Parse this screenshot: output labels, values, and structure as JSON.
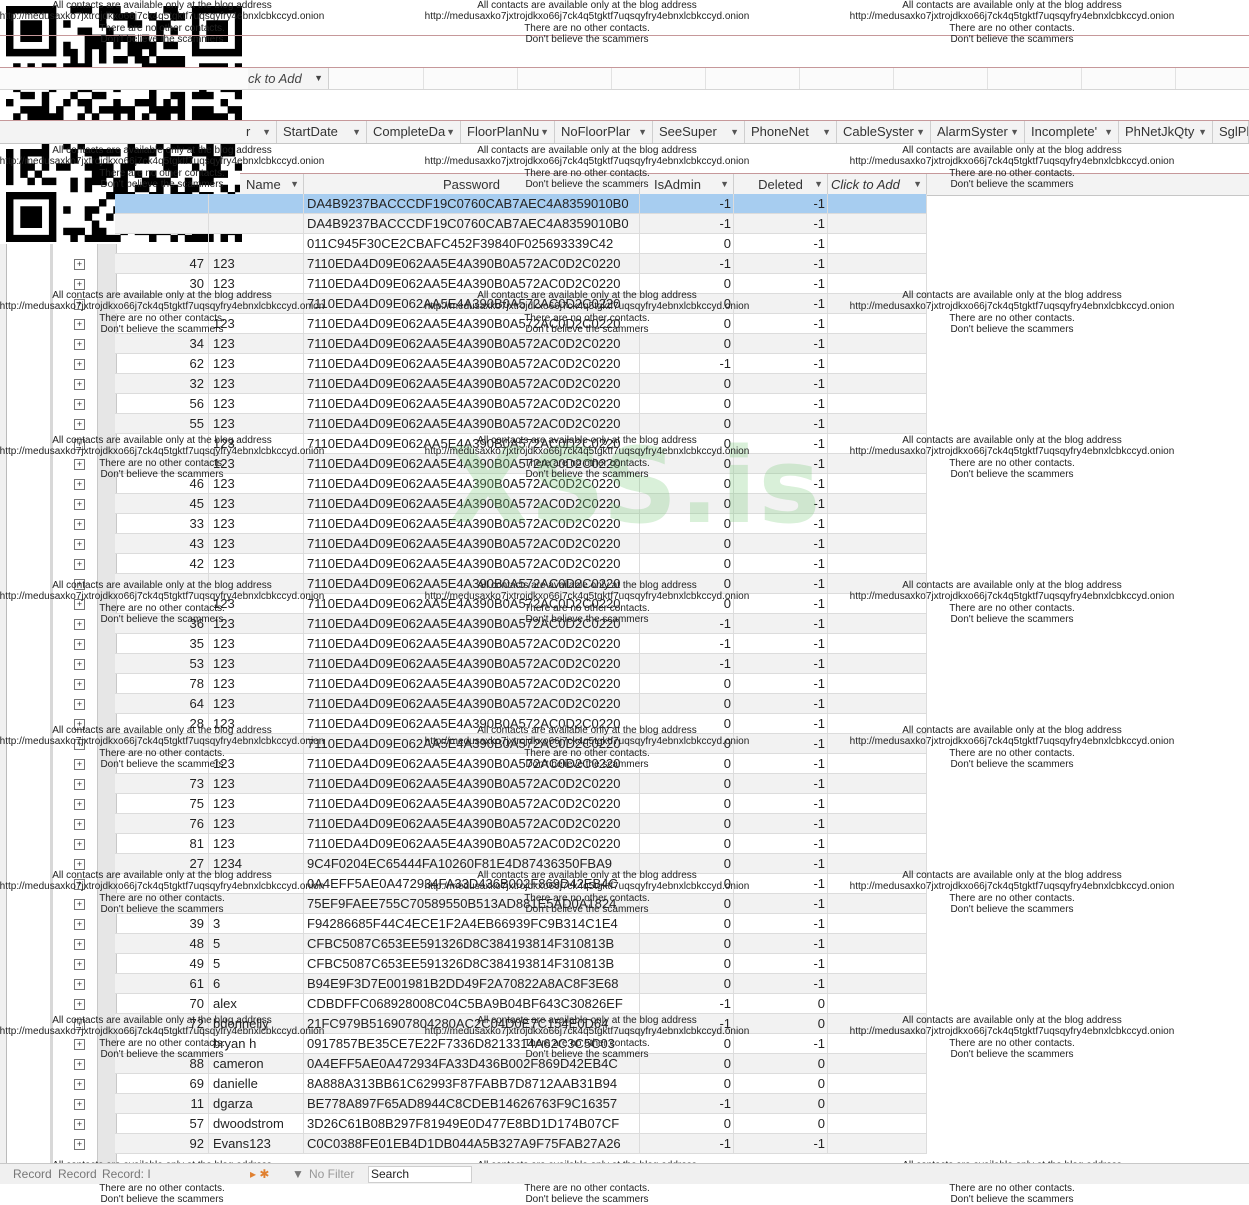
{
  "watermark": {
    "line1": "All contacts are available only at the blog address",
    "line2": "http://medusaxko7jxtrojdkxo66j7ck4q5tgktf7uqsqyfry4ebnxlcbkccyd.onion",
    "line3": "There are no other contacts.",
    "line4": "Don't believe the scammers",
    "big": "XSS.is"
  },
  "top_table": {
    "click_to_add": "ck to Add",
    "columns": [
      "r",
      "StartDate",
      "CompleteDa",
      "FloorPlanNu",
      "NoFloorPlar",
      "SeeSuper",
      "PhoneNet",
      "CableSyster",
      "AlarmSyster",
      "Incomplete'",
      "PhNetJkQty",
      "SglPh"
    ]
  },
  "sub_table": {
    "columns": [
      "Name",
      "Password",
      "IsAdmin",
      "Deleted",
      "Click to Add"
    ],
    "rows": [
      {
        "id": "",
        "name": "",
        "pw": "DA4B9237BACCCDF19C0760CAB7AEC4A8359010B0",
        "admin": "-1",
        "del": "-1"
      },
      {
        "id": "",
        "name": "",
        "pw": "DA4B9237BACCCDF19C0760CAB7AEC4A8359010B0",
        "admin": "-1",
        "del": "-1"
      },
      {
        "id": "",
        "name": "",
        "pw": "011C945F30CE2CBAFC452F39840F025693339C42",
        "admin": "0",
        "del": "-1"
      },
      {
        "id": "47",
        "name": "123",
        "pw": "7110EDA4D09E062AA5E4A390B0A572AC0D2C0220",
        "admin": "-1",
        "del": "-1"
      },
      {
        "id": "30",
        "name": "123",
        "pw": "7110EDA4D09E062AA5E4A390B0A572AC0D2C0220",
        "admin": "0",
        "del": "-1"
      },
      {
        "id": "",
        "name": "",
        "pw": "7110EDA4D09E062AA5E4A390B0A572AC0D2C0220",
        "admin": "0",
        "del": "-1"
      },
      {
        "id": "",
        "name": "123",
        "pw": "7110EDA4D09E062AA5E4A390B0A572AC0D2C0220",
        "admin": "0",
        "del": "-1"
      },
      {
        "id": "34",
        "name": "123",
        "pw": "7110EDA4D09E062AA5E4A390B0A572AC0D2C0220",
        "admin": "0",
        "del": "-1"
      },
      {
        "id": "62",
        "name": "123",
        "pw": "7110EDA4D09E062AA5E4A390B0A572AC0D2C0220",
        "admin": "-1",
        "del": "-1"
      },
      {
        "id": "32",
        "name": "123",
        "pw": "7110EDA4D09E062AA5E4A390B0A572AC0D2C0220",
        "admin": "0",
        "del": "-1"
      },
      {
        "id": "56",
        "name": "123",
        "pw": "7110EDA4D09E062AA5E4A390B0A572AC0D2C0220",
        "admin": "0",
        "del": "-1"
      },
      {
        "id": "55",
        "name": "123",
        "pw": "7110EDA4D09E062AA5E4A390B0A572AC0D2C0220",
        "admin": "0",
        "del": "-1"
      },
      {
        "id": "",
        "name": "123",
        "pw": "7110EDA4D09E062AA5E4A390B0A572AC0D2C0220",
        "admin": "0",
        "del": "-1"
      },
      {
        "id": "",
        "name": "123",
        "pw": "7110EDA4D09E062AA5E4A390B0A572AC0D2C0220",
        "admin": "0",
        "del": "-1"
      },
      {
        "id": "46",
        "name": "123",
        "pw": "7110EDA4D09E062AA5E4A390B0A572AC0D2C0220",
        "admin": "0",
        "del": "-1"
      },
      {
        "id": "45",
        "name": "123",
        "pw": "7110EDA4D09E062AA5E4A390B0A572AC0D2C0220",
        "admin": "0",
        "del": "-1"
      },
      {
        "id": "33",
        "name": "123",
        "pw": "7110EDA4D09E062AA5E4A390B0A572AC0D2C0220",
        "admin": "0",
        "del": "-1"
      },
      {
        "id": "43",
        "name": "123",
        "pw": "7110EDA4D09E062AA5E4A390B0A572AC0D2C0220",
        "admin": "0",
        "del": "-1"
      },
      {
        "id": "42",
        "name": "123",
        "pw": "7110EDA4D09E062AA5E4A390B0A572AC0D2C0220",
        "admin": "0",
        "del": "-1"
      },
      {
        "id": "",
        "name": "",
        "pw": "7110EDA4D09E062AA5E4A390B0A572AC0D2C0220",
        "admin": "0",
        "del": "-1"
      },
      {
        "id": "",
        "name": "123",
        "pw": "7110EDA4D09E062AA5E4A390B0A572AC0D2C0220",
        "admin": "0",
        "del": "-1"
      },
      {
        "id": "36",
        "name": "123",
        "pw": "7110EDA4D09E062AA5E4A390B0A572AC0D2C0220",
        "admin": "-1",
        "del": "-1"
      },
      {
        "id": "35",
        "name": "123",
        "pw": "7110EDA4D09E062AA5E4A390B0A572AC0D2C0220",
        "admin": "-1",
        "del": "-1"
      },
      {
        "id": "53",
        "name": "123",
        "pw": "7110EDA4D09E062AA5E4A390B0A572AC0D2C0220",
        "admin": "-1",
        "del": "-1"
      },
      {
        "id": "78",
        "name": "123",
        "pw": "7110EDA4D09E062AA5E4A390B0A572AC0D2C0220",
        "admin": "0",
        "del": "-1"
      },
      {
        "id": "64",
        "name": "123",
        "pw": "7110EDA4D09E062AA5E4A390B0A572AC0D2C0220",
        "admin": "0",
        "del": "-1"
      },
      {
        "id": "28",
        "name": "123",
        "pw": "7110EDA4D09E062AA5E4A390B0A572AC0D2C0220",
        "admin": "0",
        "del": "-1"
      },
      {
        "id": "",
        "name": "",
        "pw": "7110EDA4D09E062AA5E4A390B0A572AC0D2C0220",
        "admin": "0",
        "del": "-1"
      },
      {
        "id": "",
        "name": "123",
        "pw": "7110EDA4D09E062AA5E4A390B0A572AC0D2C0220",
        "admin": "0",
        "del": "-1"
      },
      {
        "id": "73",
        "name": "123",
        "pw": "7110EDA4D09E062AA5E4A390B0A572AC0D2C0220",
        "admin": "0",
        "del": "-1"
      },
      {
        "id": "75",
        "name": "123",
        "pw": "7110EDA4D09E062AA5E4A390B0A572AC0D2C0220",
        "admin": "0",
        "del": "-1"
      },
      {
        "id": "76",
        "name": "123",
        "pw": "7110EDA4D09E062AA5E4A390B0A572AC0D2C0220",
        "admin": "0",
        "del": "-1"
      },
      {
        "id": "81",
        "name": "123",
        "pw": "7110EDA4D09E062AA5E4A390B0A572AC0D2C0220",
        "admin": "0",
        "del": "-1"
      },
      {
        "id": "27",
        "name": "1234",
        "pw": "9C4F0204EC65444FA10260F81E4D87436350FBA9",
        "admin": "0",
        "del": "-1"
      },
      {
        "id": "",
        "name": "",
        "pw": "0A4EFF5AE0A472934FA33D436B002F869D42EB4C",
        "admin": "0",
        "del": "-1"
      },
      {
        "id": "",
        "name": "",
        "pw": "75EF9FAEE755C70589550B513AD881E5AD0A1824",
        "admin": "0",
        "del": "-1"
      },
      {
        "id": "39",
        "name": "3",
        "pw": "F94286685F44C4ECE1F2A4EB66939FC9B314C1E4",
        "admin": "0",
        "del": "-1"
      },
      {
        "id": "48",
        "name": "5",
        "pw": "CFBC5087C653EE591326D8C384193814F310813B",
        "admin": "0",
        "del": "-1"
      },
      {
        "id": "49",
        "name": "5",
        "pw": "CFBC5087C653EE591326D8C384193814F310813B",
        "admin": "0",
        "del": "-1"
      },
      {
        "id": "61",
        "name": "6",
        "pw": "B94E9F3D7E001981B2DD49F2A70822A8AC8F3E68",
        "admin": "0",
        "del": "-1"
      },
      {
        "id": "70",
        "name": "alex",
        "pw": "CDBDFFC068928008C04C5BA9B04BF643C30826EF",
        "admin": "-1",
        "del": "0"
      },
      {
        "id": "72",
        "name": "bdonnelly",
        "pw": "21FC979B516907804280AC2C04D0E7C154E0D64",
        "admin": "-1",
        "del": "0"
      },
      {
        "id": "",
        "name": "bryan h",
        "pw": "0917857BE35CE7E22F7336D8213314A62C3C5C03",
        "admin": "0",
        "del": "-1"
      },
      {
        "id": "88",
        "name": "cameron",
        "pw": "0A4EFF5AE0A472934FA33D436B002F869D42EB4C",
        "admin": "0",
        "del": "0"
      },
      {
        "id": "69",
        "name": "danielle",
        "pw": "8A888A313BB61C62993F87FABB7D8712AAB31B94",
        "admin": "0",
        "del": "0"
      },
      {
        "id": "11",
        "name": "dgarza",
        "pw": "BE778A897F65AD8944C8CDEB14626763F9C16357",
        "admin": "-1",
        "del": "0"
      },
      {
        "id": "57",
        "name": "dwoodstrom",
        "pw": "3D26C61B08B297F81949E0D477E8BD1D174B07CF",
        "admin": "0",
        "del": "0"
      },
      {
        "id": "92",
        "name": "Evans123",
        "pw": "C0C0388FE01EB4D1DB044A5B327A9F75FAB27A26",
        "admin": "-1",
        "del": "-1"
      }
    ]
  },
  "status_bar": {
    "record1": "Record",
    "record2": "Record",
    "record3": "Record: I",
    "no_filter": "No Filter",
    "search": "Search"
  }
}
